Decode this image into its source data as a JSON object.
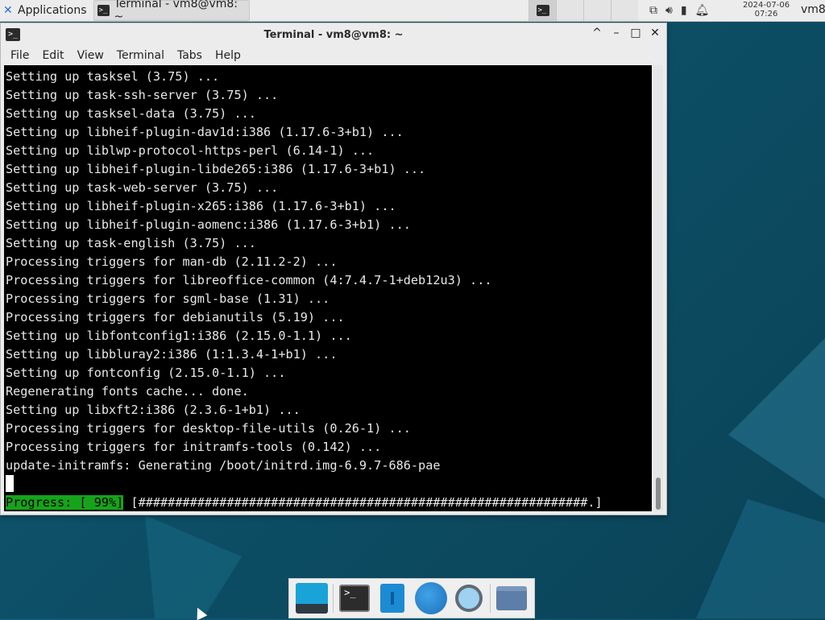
{
  "top_panel": {
    "applications_label": "Applications",
    "task_label": "Terminal - vm8@vm8: ~",
    "clock_date": "2024-07-06",
    "clock_time": "07:26",
    "user": "vm8"
  },
  "window": {
    "title": "Terminal - vm8@vm8: ~",
    "menu": [
      "File",
      "Edit",
      "View",
      "Terminal",
      "Tabs",
      "Help"
    ],
    "controls": [
      "^",
      "–",
      "□",
      "✕"
    ]
  },
  "terminal": {
    "lines": [
      "Setting up tasksel (3.75) ...",
      "Setting up task-ssh-server (3.75) ...",
      "Setting up tasksel-data (3.75) ...",
      "Setting up libheif-plugin-dav1d:i386 (1.17.6-3+b1) ...",
      "Setting up liblwp-protocol-https-perl (6.14-1) ...",
      "Setting up libheif-plugin-libde265:i386 (1.17.6-3+b1) ...",
      "Setting up task-web-server (3.75) ...",
      "Setting up libheif-plugin-x265:i386 (1.17.6-3+b1) ...",
      "Setting up libheif-plugin-aomenc:i386 (1.17.6-3+b1) ...",
      "Setting up task-english (3.75) ...",
      "Processing triggers for man-db (2.11.2-2) ...",
      "Processing triggers for libreoffice-common (4:7.4.7-1+deb12u3) ...",
      "Processing triggers for sgml-base (1.31) ...",
      "Processing triggers for debianutils (5.19) ...",
      "Setting up libfontconfig1:i386 (2.15.0-1.1) ...",
      "Setting up libbluray2:i386 (1:1.3.4-1+b1) ...",
      "Setting up fontconfig (2.15.0-1.1) ...",
      "Regenerating fonts cache... done.",
      "Setting up libxft2:i386 (2.3.6-1+b1) ...",
      "Processing triggers for desktop-file-utils (0.26-1) ...",
      "Processing triggers for initramfs-tools (0.142) ...",
      "update-initramfs: Generating /boot/initrd.img-6.9.7-686-pae"
    ],
    "progress_label": "Progress: [ 99%]",
    "progress_bar": " [#############################################################.]",
    "progress_color": "#16a31a"
  },
  "dock": {
    "items": [
      "desktop-icon",
      "terminal-icon",
      "file-manager-icon",
      "web-browser-icon",
      "app-finder-icon",
      "folder-icon"
    ]
  }
}
